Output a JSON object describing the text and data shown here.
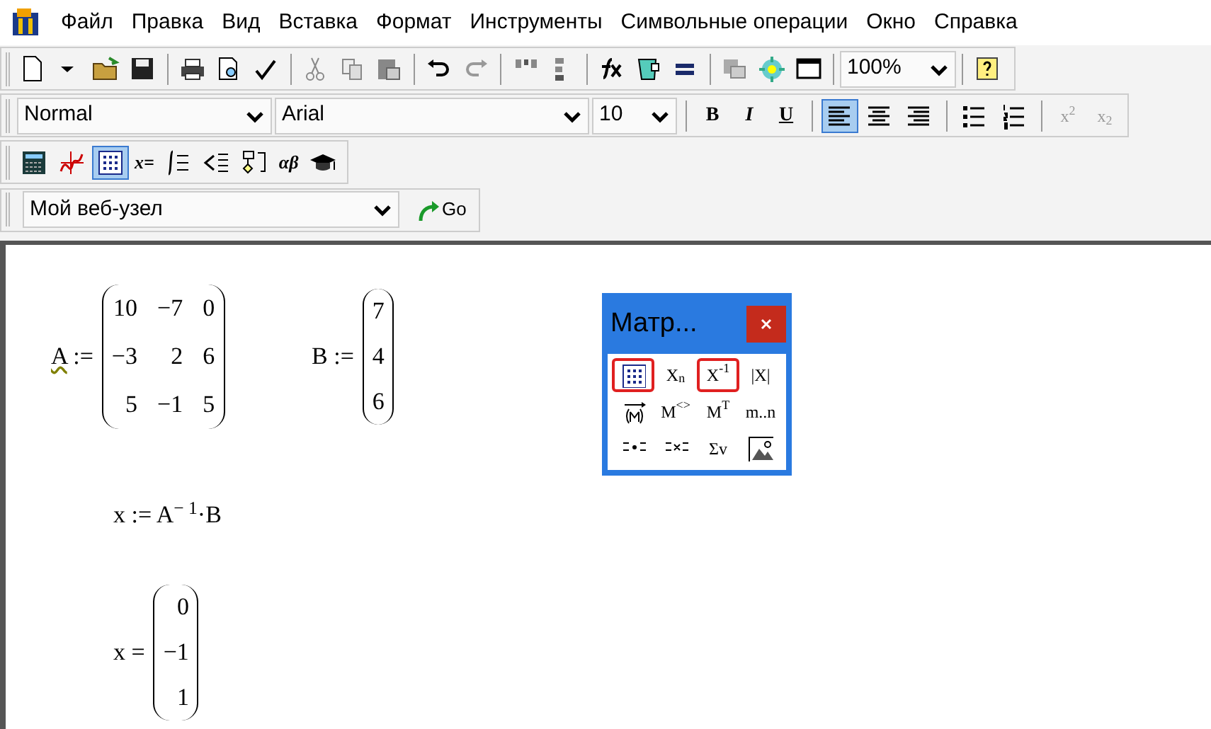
{
  "menu": [
    "Файл",
    "Правка",
    "Вид",
    "Вставка",
    "Формат",
    "Инструменты",
    "Символьные операции",
    "Окно",
    "Справка"
  ],
  "standard_toolbar": {
    "zoom": "100%"
  },
  "format_toolbar": {
    "style": "Normal",
    "font": "Arial",
    "size": "10",
    "buttons": [
      {
        "kind": "bold",
        "label": "B",
        "selected": false
      },
      {
        "kind": "italic",
        "label": "I",
        "selected": false
      },
      {
        "kind": "underline",
        "label": "U",
        "selected": false
      },
      {
        "kind": "align_left",
        "selected": true
      },
      {
        "kind": "align_center",
        "selected": false
      },
      {
        "kind": "align_right",
        "selected": false
      },
      {
        "kind": "bullets",
        "selected": false
      },
      {
        "kind": "numbering",
        "selected": false
      },
      {
        "kind": "script",
        "label": "x$^{2}$",
        "selected": false
      },
      {
        "kind": "script",
        "label": "x$_{2}$",
        "selected": false
      }
    ]
  },
  "math_toolbar": [
    {
      "kind": "calculator",
      "selected": false
    },
    {
      "kind": "graph",
      "selected": false
    },
    {
      "kind": "matrix",
      "selected": true
    },
    {
      "kind": "text",
      "label": "x=",
      "selected": false
    },
    {
      "kind": "calculus",
      "selected": false
    },
    {
      "kind": "boolean",
      "selected": false
    },
    {
      "kind": "programming",
      "selected": false
    },
    {
      "kind": "text",
      "label": "αβ",
      "selected": false
    },
    {
      "kind": "symbolic",
      "selected": false
    }
  ],
  "web_toolbar": {
    "address": "Мой веб-узел",
    "go": "Go"
  },
  "worksheet": [
    {
      "kind": "matrix",
      "name": "A",
      "operator": ":=",
      "flagged": true,
      "rows": [
        [
          "10",
          "−7",
          "0"
        ],
        [
          "−3",
          "2",
          "6"
        ],
        [
          "5",
          "−1",
          "5"
        ]
      ]
    },
    {
      "kind": "matrix",
      "name": "B",
      "operator": ":=",
      "flagged": false,
      "rows": [
        [
          "7"
        ],
        [
          "4"
        ],
        [
          "6"
        ]
      ]
    },
    {
      "kind": "formula",
      "text": "x := A$^{− 1}$·B"
    },
    {
      "kind": "matrix",
      "name": "x",
      "operator": "=",
      "flagged": false,
      "rows": [
        [
          "0"
        ],
        [
          "−1"
        ],
        [
          "1"
        ]
      ]
    }
  ],
  "palette": {
    "title": "Матр...",
    "buttons": [
      {
        "kind": "matrix",
        "selected": true
      },
      {
        "kind": "text",
        "label": "X$_{n}$",
        "selected": false
      },
      {
        "kind": "text",
        "label": "X$^{-1}$",
        "selected": true
      },
      {
        "kind": "text",
        "label": "|X|",
        "selected": false
      },
      {
        "kind": "vectorize",
        "selected": false
      },
      {
        "kind": "text",
        "label": "M$^{<>}$",
        "selected": false
      },
      {
        "kind": "text",
        "label": "M$^{T}$",
        "selected": false
      },
      {
        "kind": "text",
        "label": "m..n",
        "selected": false
      },
      {
        "kind": "dot_product",
        "selected": false
      },
      {
        "kind": "cross_product",
        "selected": false
      },
      {
        "kind": "text",
        "label": "Σv",
        "selected": false
      },
      {
        "kind": "picture",
        "selected": false
      }
    ]
  }
}
